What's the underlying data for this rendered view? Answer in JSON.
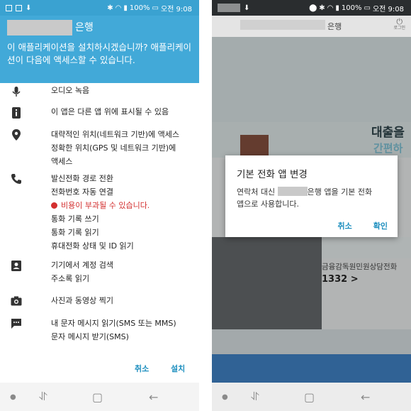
{
  "status_bar": {
    "battery": "100%",
    "time": "오전 9:08"
  },
  "install_screen": {
    "bank_label": "은행",
    "question": "이 애플리케이션을 설치하시겠습니까? 애플리케이션이 다음에 액세스할 수 있습니다.",
    "permissions": [
      {
        "icon": "microphone-icon",
        "lines": [
          "오디오 녹음"
        ]
      },
      {
        "icon": "info-icon",
        "lines": [
          "이 앱은 다른 앱 위에 표시될 수 있음"
        ]
      },
      {
        "icon": "location-pin-icon",
        "lines": [
          "대략적인 위치(네트워크 기반)에 액세스",
          "정확한 위치(GPS 및 네트워크 기반)에",
          "액세스"
        ]
      },
      {
        "icon": "phone-icon",
        "lines": [
          "발신전화 경로 전환",
          "전화번호 자동 연결"
        ],
        "warning": "비용이 부과될 수 있습니다.",
        "lines_after": [
          "통화 기록 쓰기",
          "통화 기록 읽기",
          "휴대전화 상태 및 ID 읽기"
        ]
      },
      {
        "icon": "contacts-icon",
        "lines": [
          "기기에서 계정 검색",
          "주소록 읽기"
        ]
      },
      {
        "icon": "camera-icon",
        "lines": [
          "사진과 동영상 찍기"
        ]
      },
      {
        "icon": "message-icon",
        "lines": [
          "내 문자 메시지 읽기(SMS 또는 MMS)",
          "문자 메시지 받기(SMS)"
        ]
      }
    ],
    "cancel_label": "취소",
    "install_label": "설치"
  },
  "app_screen": {
    "header_title": "은행",
    "logout_label": "로그인",
    "banner_text_1": "대출을",
    "banner_text_2": "간편하게",
    "dialog": {
      "title": "기본 전화 앱 변경",
      "body_prefix": "연락처 대신",
      "body_suffix": "은행 앱을 기본 전화",
      "body_line2": "앱으로 사용합니다.",
      "cancel_label": "취소",
      "confirm_label": "확인"
    },
    "hotline_label": "금융감독원민원상담전화",
    "hotline_number": "1332 >"
  },
  "colors": {
    "header_blue": "#42a9d8",
    "accent": "#1e8fbf",
    "warning_red": "#d32f2f"
  }
}
